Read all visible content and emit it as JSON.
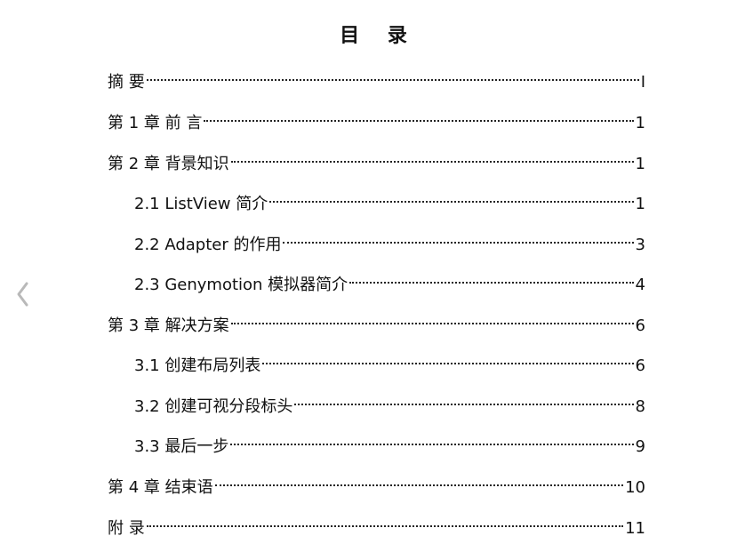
{
  "title": "目 录",
  "entries": [
    {
      "label": "摘  要",
      "page": "I",
      "level": 1
    },
    {
      "label": "第 1 章  前  言",
      "page": "1",
      "level": 1
    },
    {
      "label": "第 2 章  背景知识",
      "page": "1",
      "level": 1
    },
    {
      "label": "2.1 ListView 简介",
      "page": "1",
      "level": 2
    },
    {
      "label": "2.2 Adapter 的作用",
      "page": "3",
      "level": 2
    },
    {
      "label": "2.3 Genymotion 模拟器简介",
      "page": "4",
      "level": 2
    },
    {
      "label": "第 3 章  解决方案",
      "page": "6",
      "level": 1
    },
    {
      "label": "3.1  创建布局列表",
      "page": "6",
      "level": 2
    },
    {
      "label": "3.2  创建可视分段标头",
      "page": "8",
      "level": 2
    },
    {
      "label": "3.3  最后一步",
      "page": "9",
      "level": 2
    },
    {
      "label": "第 4 章  结束语",
      "page": "10",
      "level": 1
    },
    {
      "label": "附  录",
      "page": "11",
      "level": 1
    }
  ],
  "icons": {
    "nav_prev": "chevron-left-icon"
  },
  "colors": {
    "text": "#111111",
    "leader": "#222222",
    "nav_arrow": "#b9b9b9"
  }
}
